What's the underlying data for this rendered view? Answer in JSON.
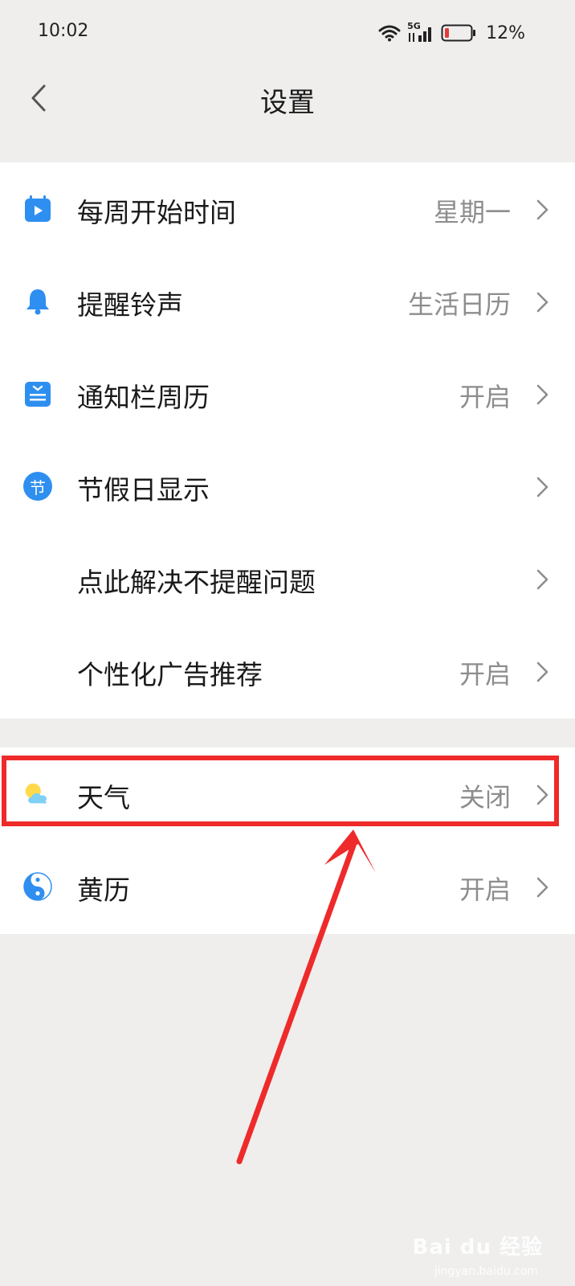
{
  "status_bar": {
    "time": "10:02",
    "network": "5G",
    "battery": "12%"
  },
  "header": {
    "title": "设置"
  },
  "settings_group_1": [
    {
      "label": "每周开始时间",
      "value": "星期一",
      "icon": "calendar-play-icon"
    },
    {
      "label": "提醒铃声",
      "value": "生活日历",
      "icon": "bell-icon"
    },
    {
      "label": "通知栏周历",
      "value": "开启",
      "icon": "notification-calendar-icon"
    },
    {
      "label": "节假日显示",
      "value": "",
      "icon": "holiday-icon",
      "icon_text": "节"
    },
    {
      "label": "点此解决不提醒问题",
      "value": "",
      "icon": ""
    },
    {
      "label": "个性化广告推荐",
      "value": "开启",
      "icon": ""
    }
  ],
  "settings_group_2": [
    {
      "label": "天气",
      "value": "关闭",
      "icon": "weather-icon"
    },
    {
      "label": "黄历",
      "value": "开启",
      "icon": "yin-yang-icon"
    }
  ],
  "annotation": {
    "highlight_color": "#ee2a2a"
  },
  "watermark": {
    "text": "Bai du 经验",
    "sub": "jingyan.baidu.com"
  },
  "colors": {
    "accent": "#2f8ff0",
    "background": "#efeeed",
    "value_text": "#8d8d8d"
  }
}
